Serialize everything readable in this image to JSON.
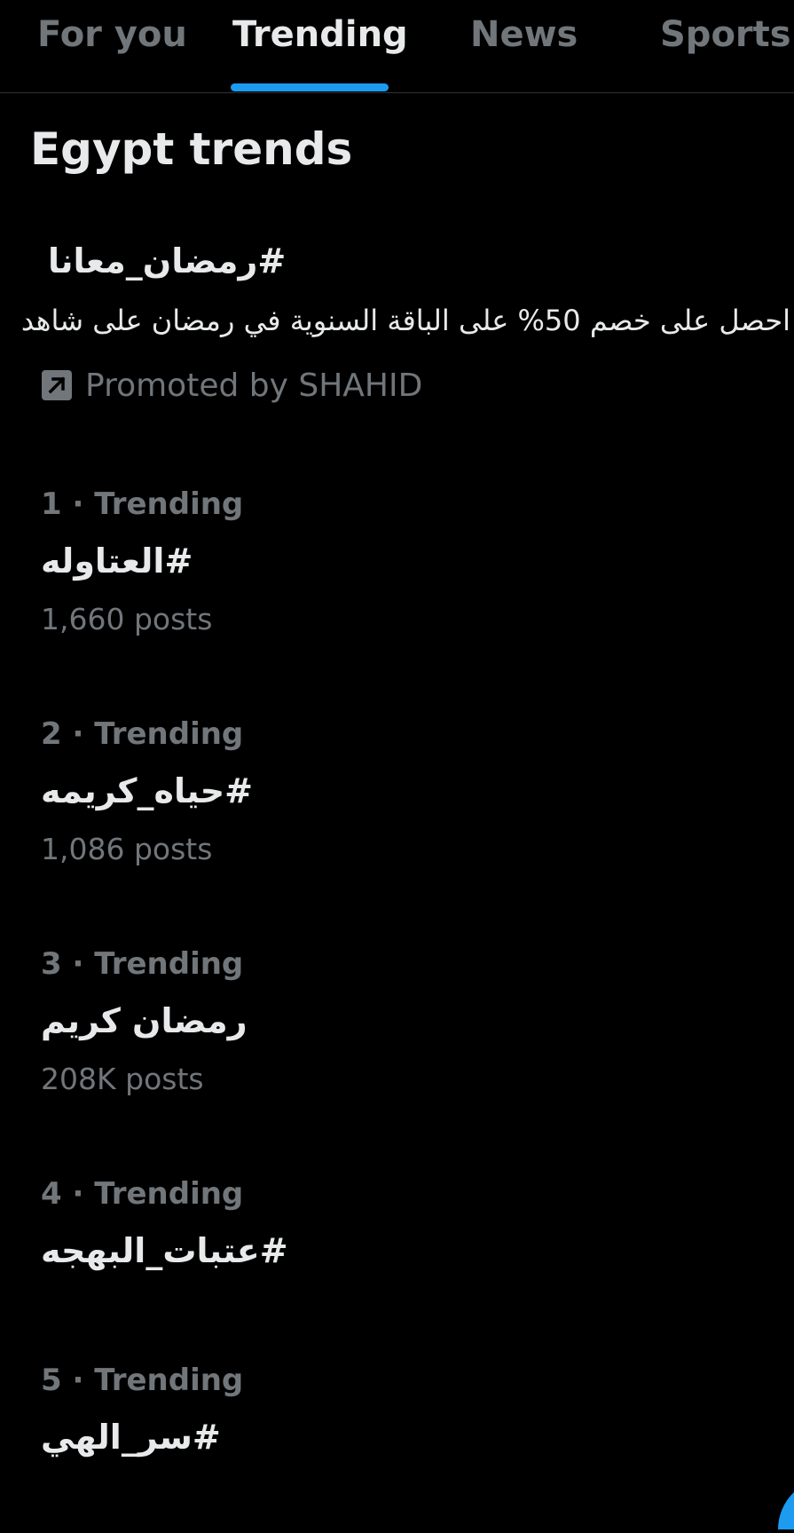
{
  "tabs": [
    {
      "label": "For you",
      "active": false
    },
    {
      "label": "Trending",
      "active": true
    },
    {
      "label": "News",
      "active": false
    },
    {
      "label": "Sports",
      "active": false
    }
  ],
  "accent_color": "#1d9bf0",
  "section_title": "Egypt trends",
  "promoted": {
    "hashtag": "#رمضان_معانا",
    "description": "احصل على خصم 50% على الباقة السنوية في رمضان على شاهد",
    "label": "Promoted by SHAHID",
    "icon": "promoted-arrow-icon"
  },
  "trends": [
    {
      "meta": "1 · Trending",
      "name": "#العتاوله",
      "posts": "1,660 posts"
    },
    {
      "meta": "2 · Trending",
      "name": "#حياه_كريمه",
      "posts": "1,086 posts"
    },
    {
      "meta": "3 · Trending",
      "name": "رمضان كريم",
      "posts": "208K posts"
    },
    {
      "meta": "4 · Trending",
      "name": "#عتبات_البهجه",
      "posts": ""
    },
    {
      "meta": "5 · Trending",
      "name": "#سر_الهي",
      "posts": ""
    }
  ]
}
